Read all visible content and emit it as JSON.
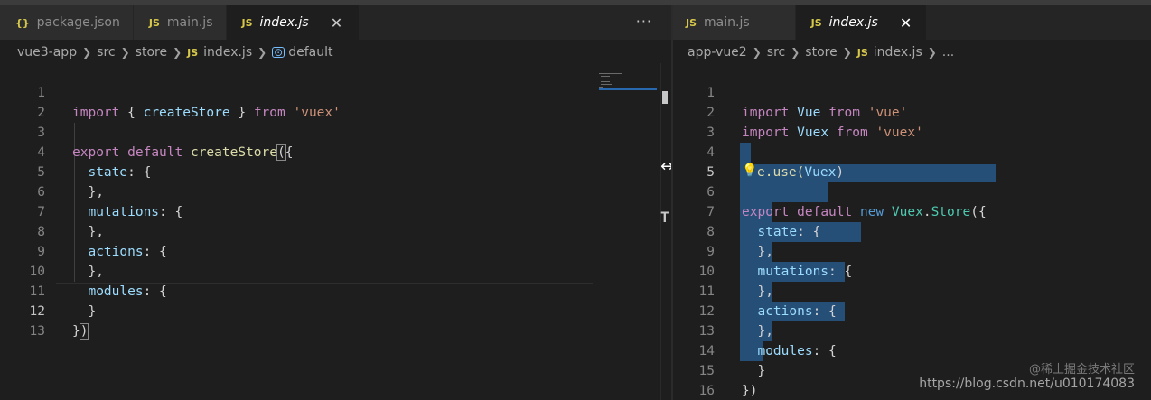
{
  "left": {
    "tabs": [
      {
        "icon": "{}",
        "label": "package.json",
        "active": false
      },
      {
        "icon": "JS",
        "label": "main.js",
        "active": false
      },
      {
        "icon": "JS",
        "label": "index.js",
        "active": true,
        "close": "✕"
      }
    ],
    "more": "···",
    "breadcrumb": {
      "p1": "vue3-app",
      "p2": "src",
      "p3": "store",
      "js": "JS",
      "p4": "index.js",
      "sym": "⊙",
      "p5": "default"
    },
    "lines": [
      "1",
      "2",
      "3",
      "4",
      "5",
      "6",
      "7",
      "8",
      "9",
      "10",
      "11",
      "12",
      "13"
    ]
  },
  "right": {
    "tabs": [
      {
        "icon": "JS",
        "label": "main.js",
        "active": false
      },
      {
        "icon": "JS",
        "label": "index.js",
        "active": true,
        "close": "✕"
      }
    ],
    "breadcrumb": {
      "p1": "app-vue2",
      "p2": "src",
      "p3": "store",
      "js": "JS",
      "p4": "index.js",
      "p5": "..."
    },
    "lines": [
      "1",
      "2",
      "3",
      "4",
      "5",
      "6",
      "7",
      "8",
      "9",
      "10",
      "11",
      "12",
      "13",
      "14",
      "15",
      "16"
    ]
  },
  "code": {
    "import": "import",
    "from": "from",
    "export": "export",
    "default": "default",
    "new": "new",
    "lbrace": "{",
    "rbrace": "}",
    "rbrace_comma": "},",
    "lparen_brace": "({",
    "rbrace_paren_close": "})",
    "createStore": "createStore",
    "vuex_str": "'vuex'",
    "vue_str": "'vue'",
    "Vue": "Vue",
    "Vuex": "Vuex",
    "Store": "Store",
    "dot": ".",
    "state": "state",
    "mutations": "mutations",
    "actions": "actions",
    "modules": "modules",
    "colon_brace": ": {",
    "use_open": "e.use(",
    "rparen": ")",
    "open_brace_sp": "{ ",
    "close_brace_sp": " }",
    "rbrace_paren": "}",
    "rparen_close": ")",
    "left_paren": "(",
    "cs_open": "({"
  },
  "ui": {
    "resize_cursor": "↔",
    "bulb": "💡",
    "watermark": "https://blog.csdn.net/u010174083",
    "watermark_cn": "@稀土掘金技术社区"
  },
  "colors": {
    "keyword": "#c586c0",
    "function": "#dcdcaa",
    "string": "#ce9178",
    "variable": "#9cdcfe",
    "selection": "#264f78"
  }
}
